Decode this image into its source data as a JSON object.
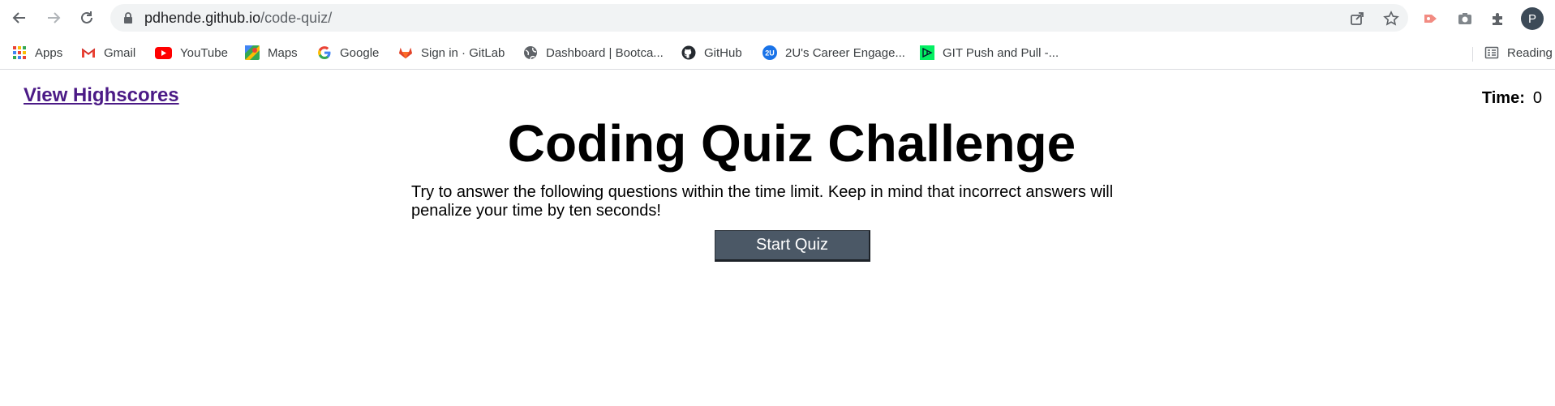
{
  "browser": {
    "url_host": "pdhende.github.io",
    "url_path": "/code-quiz/",
    "profile_initial": "P"
  },
  "bookmarks": [
    {
      "label": "Apps",
      "icon": "apps-grid-icon"
    },
    {
      "label": "Gmail",
      "icon": "gmail-icon"
    },
    {
      "label": "YouTube",
      "icon": "youtube-icon"
    },
    {
      "label": "Maps",
      "icon": "maps-icon"
    },
    {
      "label": "Google",
      "icon": "google-icon"
    },
    {
      "label": "Sign in · GitLab",
      "icon": "gitlab-icon"
    },
    {
      "label": "Dashboard | Bootca...",
      "icon": "globe-icon"
    },
    {
      "label": "GitHub",
      "icon": "github-icon"
    },
    {
      "label": "2U's Career Engage...",
      "icon": "2u-icon"
    },
    {
      "label": "GIT Push and Pull -...",
      "icon": "dc-icon"
    },
    {
      "label": "Reading",
      "icon": "reading-list-icon"
    }
  ],
  "page": {
    "highscores_link": "View Highscores",
    "time_label": "Time:",
    "time_value": "0",
    "title": "Coding Quiz Challenge",
    "intro": "Try to answer the following questions within the time limit. Keep in mind that incorrect answers will penalize your time by ten seconds!",
    "start_button": "Start Quiz"
  },
  "colors": {
    "link": "#4b1a86",
    "button_bg": "#4b5866",
    "omnibox_bg": "#f1f3f4"
  }
}
